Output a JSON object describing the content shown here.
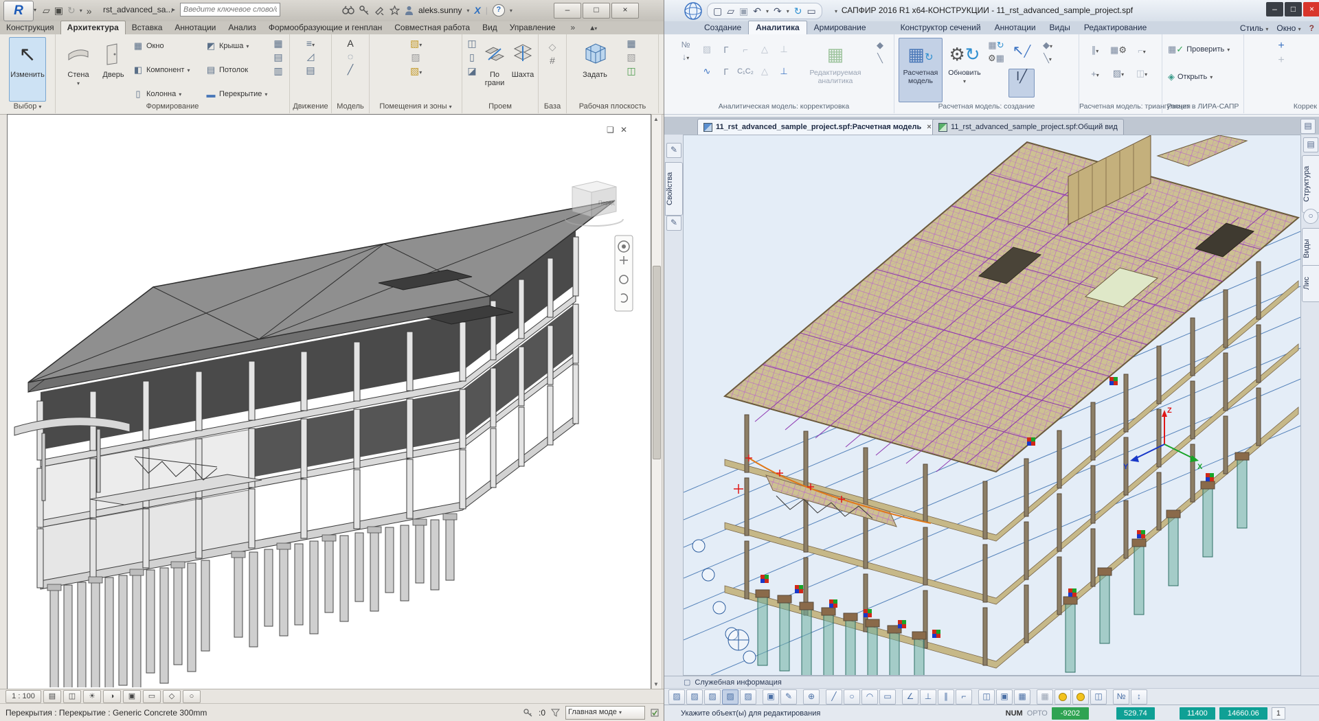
{
  "revit": {
    "app_button": "R",
    "title": "rst_advanced_sa...",
    "search_placeholder": "Введите ключевое слово/фразу",
    "user": "aleks.sunny",
    "tabs": [
      "Конструкция",
      "Архитектура",
      "Вставка",
      "Аннотации",
      "Анализ",
      "Формообразующие и генплан",
      "Совместная работа",
      "Вид",
      "Управление"
    ],
    "active_tab": "Архитектура",
    "ribbon": {
      "modify": "Изменить",
      "wall": "Стена",
      "door": "Дверь",
      "window": "Окно",
      "component": "Компонент",
      "column": "Колонна",
      "roof": "Крыша",
      "ceiling": "Потолок",
      "floor": "Перекрытие",
      "by_face_line1": "По",
      "by_face_line2": "грани",
      "shaft": "Шахта",
      "set_workplane": "Задать",
      "panel_labels": [
        "Выбор",
        "Формирование",
        "Движение",
        "Модель",
        "Помещения и зоны",
        "Проем",
        "База",
        "Рабочая плоскость"
      ]
    },
    "viewcube_label": "Перед",
    "view_scale": "1 : 100",
    "status_selection": "Перекрытия : Перекрытие : Generic Concrete 300mm",
    "status_requests": ":0",
    "status_model_dropdown": "Главная моде"
  },
  "sapfir": {
    "title": "САПФИР 2016 R1 x64-КОНСТРУКЦИИ - 11_rst_advanced_sample_project.spf",
    "tabs": [
      "Создание",
      "Аналитика",
      "Армирование",
      "Конструктор сечений",
      "Аннотации",
      "Виды",
      "Редактирование"
    ],
    "active_tab": "Аналитика",
    "menu_style": "Стиль",
    "menu_window": "Окно",
    "ribbon": {
      "editable_line1": "Редактируемая",
      "editable_line2": "аналитика",
      "calc_line1": "Расчетная",
      "calc_line2": "модель",
      "update": "Обновить",
      "check": "Проверить",
      "open": "Открыть",
      "c1c2": "C₁C₂",
      "group_labels": [
        "Аналитическая модель: корректировка",
        "Расчетная модель: создание",
        "Расчетная модель: триангуляция",
        "Расчет в ЛИРА-САПР",
        "Коррек"
      ]
    },
    "doc_tabs": [
      "11_rst_advanced_sample_project.spf:Расчетная модель",
      "11_rst_advanced_sample_project.spf:Общий вид"
    ],
    "left_panel_tab": "Свойства",
    "right_panel_tabs": [
      "Структура",
      "Виды",
      "Лис"
    ],
    "service_info": "Служебная информация",
    "status_prompt": "Укажите объект(ы) для редактирования",
    "status_num": "NUM",
    "status_orto": "ОРТО",
    "coord_x": "-9202",
    "coord_y": "529.74",
    "coord_z": "11400",
    "coord_d": "14660.06",
    "sheet_n": "1",
    "axis_x": "X",
    "axis_y": "Y",
    "axis_z": "Z"
  },
  "colors": {
    "value_green": "#2fa352",
    "value_teal": "#0fa095",
    "close_red": "#d8352b",
    "accent_blue": "#4a78b8",
    "mesh_purple": "#a447c0",
    "slab_tan": "#cdc192",
    "pile_teal": "#5da496"
  },
  "icons": {
    "caret": "▾",
    "chevrons": "»",
    "play": "▸",
    "minimize": "–",
    "maximize": "□",
    "close": "×",
    "help": "?",
    "exchange": "X",
    "panel_toggle": "▴",
    "new_doc": "▢",
    "open_doc": "▱",
    "save": "▣",
    "undo": "↶",
    "redo": "↷",
    "sync": "↻",
    "ruler": "▭",
    "cursor": "↖",
    "win": "▦",
    "component": "◧",
    "column": "▯",
    "roof": "◩",
    "ceiling": "▤",
    "floor": "▬",
    "curtain_sys": "▦",
    "curtain_grid": "▤",
    "mullion": "▥",
    "railing": "≡",
    "ramp": "◿",
    "stair": "▤",
    "text_a": "А",
    "group": "◌",
    "mline": "╱",
    "room": "▧",
    "room_sep": "▨",
    "zone": "▧",
    "wall_open": "◫",
    "vert_open": "▯",
    "dormer": "◪",
    "level": "◇",
    "grid": "#",
    "show_wp": "▦",
    "wp_viewer": "▧",
    "ref_plane": "◫",
    "num": "№",
    "arrow_dn": "↓",
    "spring": "∿",
    "gamma": "Γ",
    "tri": "△",
    "perp": "⊥",
    "star4": "◆",
    "slash_b": "╲",
    "cube": "▦",
    "gear": "⚙",
    "check": "✓",
    "gem": "◈",
    "ibeam": "I",
    "pencil": "✎",
    "oplus": "⊕",
    "circle": "○",
    "arc": "◠",
    "rect": "▭",
    "angle": "∠",
    "parallel": "∥",
    "corner": "⌐",
    "hatch": "▨",
    "panel": "◫",
    "updown": "↕",
    "sun": "☀",
    "shadow": "◑",
    "detail": "▤",
    "vstyle": "◫",
    "crop": "▣",
    "isolate": "◇",
    "layers": "▤",
    "doc": "▢",
    "plus": "+"
  }
}
